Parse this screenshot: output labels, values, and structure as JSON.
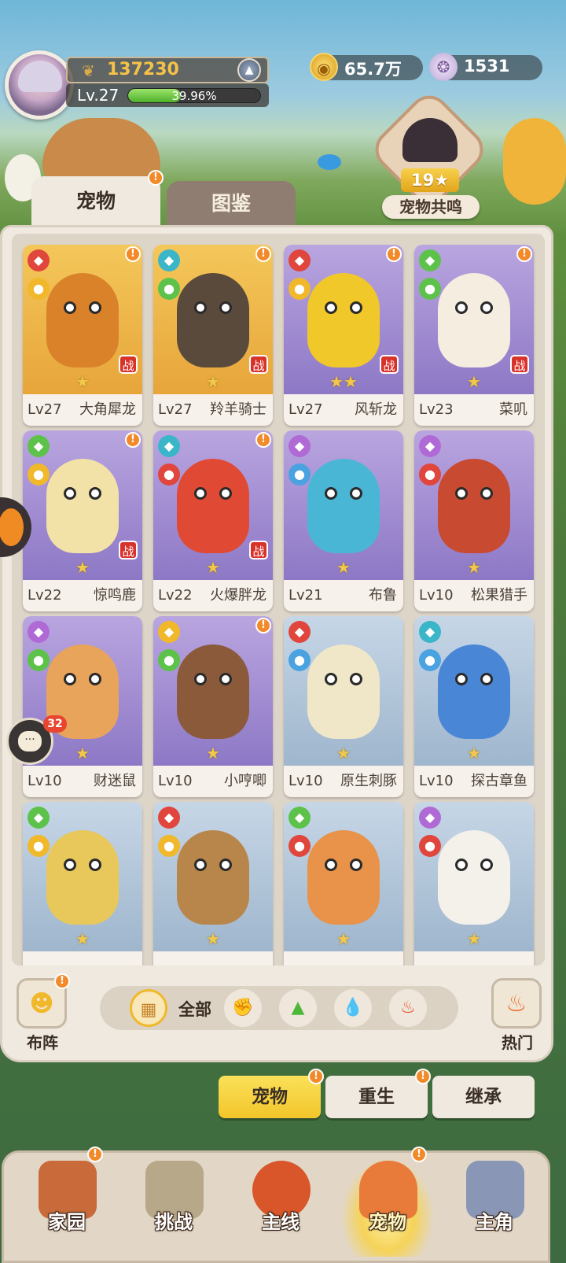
{
  "player": {
    "power": "137230",
    "level": "Lv.27",
    "exp_percent": "39.96%",
    "exp_fraction": 0.3996
  },
  "currency": {
    "coins": "65.7万",
    "shells": "1531"
  },
  "resonance": {
    "stars": "19★",
    "label": "宠物共鸣"
  },
  "tabs": {
    "pets": "宠物",
    "atlas": "图鉴"
  },
  "pets": [
    {
      "level": "Lv27",
      "name": "大角犀龙",
      "stars": "★",
      "bg": "gold",
      "battle": "战",
      "alert": true,
      "e1": "ic-red",
      "e2": "ic-yellow",
      "color": "#d9822a"
    },
    {
      "level": "Lv27",
      "name": "羚羊骑士",
      "stars": "★",
      "bg": "gold",
      "battle": "战",
      "alert": true,
      "e1": "ic-teal",
      "e2": "ic-green",
      "color": "#5a4a3c"
    },
    {
      "level": "Lv27",
      "name": "风斩龙",
      "stars": "★★",
      "bg": "purple",
      "battle": "战",
      "alert": true,
      "e1": "ic-red",
      "e2": "ic-yellow",
      "color": "#f0c82a"
    },
    {
      "level": "Lv23",
      "name": "菜叽",
      "stars": "★",
      "bg": "purple",
      "battle": "战",
      "alert": true,
      "e1": "ic-green",
      "e2": "ic-green",
      "color": "#f4ede0"
    },
    {
      "level": "Lv22",
      "name": "惊鸣鹿",
      "stars": "★",
      "bg": "purple",
      "battle": "战",
      "alert": true,
      "e1": "ic-green",
      "e2": "ic-yellow",
      "color": "#f2e2a8"
    },
    {
      "level": "Lv22",
      "name": "火爆胖龙",
      "stars": "★",
      "bg": "purple",
      "battle": "战",
      "alert": true,
      "e1": "ic-teal",
      "e2": "ic-red",
      "color": "#e04a34"
    },
    {
      "level": "Lv21",
      "name": "布鲁",
      "stars": "★",
      "bg": "purple",
      "battle": "",
      "alert": false,
      "e1": "ic-purple",
      "e2": "ic-blue",
      "color": "#4ab6d6"
    },
    {
      "level": "Lv10",
      "name": "松果猎手",
      "stars": "★",
      "bg": "purple",
      "battle": "",
      "alert": false,
      "e1": "ic-purple",
      "e2": "ic-red",
      "color": "#c84a30"
    },
    {
      "level": "Lv10",
      "name": "财迷鼠",
      "stars": "★",
      "bg": "purple",
      "battle": "",
      "alert": false,
      "e1": "ic-purple",
      "e2": "ic-green",
      "color": "#e8a45a"
    },
    {
      "level": "Lv10",
      "name": "小哼唧",
      "stars": "★",
      "bg": "purple",
      "battle": "",
      "alert": true,
      "e1": "ic-yellow",
      "e2": "ic-green",
      "color": "#8a5a3a"
    },
    {
      "level": "Lv10",
      "name": "原生刺豚",
      "stars": "★",
      "bg": "blue",
      "battle": "",
      "alert": false,
      "e1": "ic-red",
      "e2": "ic-blue",
      "color": "#f0e6c8"
    },
    {
      "level": "Lv10",
      "name": "探古章鱼",
      "stars": "★",
      "bg": "blue",
      "battle": "",
      "alert": false,
      "e1": "ic-teal",
      "e2": "ic-blue",
      "color": "#4a86d6"
    },
    {
      "level": "",
      "name": "",
      "stars": "★",
      "bg": "blue",
      "battle": "",
      "alert": false,
      "e1": "ic-green",
      "e2": "ic-yellow",
      "color": "#e8c85a"
    },
    {
      "level": "",
      "name": "",
      "stars": "★",
      "bg": "blue",
      "battle": "",
      "alert": false,
      "e1": "ic-red",
      "e2": "ic-yellow",
      "color": "#b8864a"
    },
    {
      "level": "",
      "name": "",
      "stars": "★",
      "bg": "blue",
      "battle": "",
      "alert": false,
      "e1": "ic-green",
      "e2": "ic-red",
      "color": "#e8924a"
    },
    {
      "level": "",
      "name": "",
      "stars": "★",
      "bg": "blue",
      "battle": "",
      "alert": false,
      "e1": "ic-purple",
      "e2": "ic-red",
      "color": "#f4f0ea"
    }
  ],
  "toolbar": {
    "lineup": "布阵",
    "filter_all": "全部",
    "hot": "热门"
  },
  "subtabs": {
    "pets": "宠物",
    "rebirth": "重生",
    "inherit": "继承"
  },
  "nav": {
    "home": "家园",
    "challenge": "挑战",
    "main": "主线",
    "pets": "宠物",
    "hero": "主角"
  },
  "chat": {
    "count": "32"
  },
  "colors": {
    "accent": "#f2c52a",
    "alert": "#f28a2a",
    "battle_tag": "#d8322a"
  }
}
